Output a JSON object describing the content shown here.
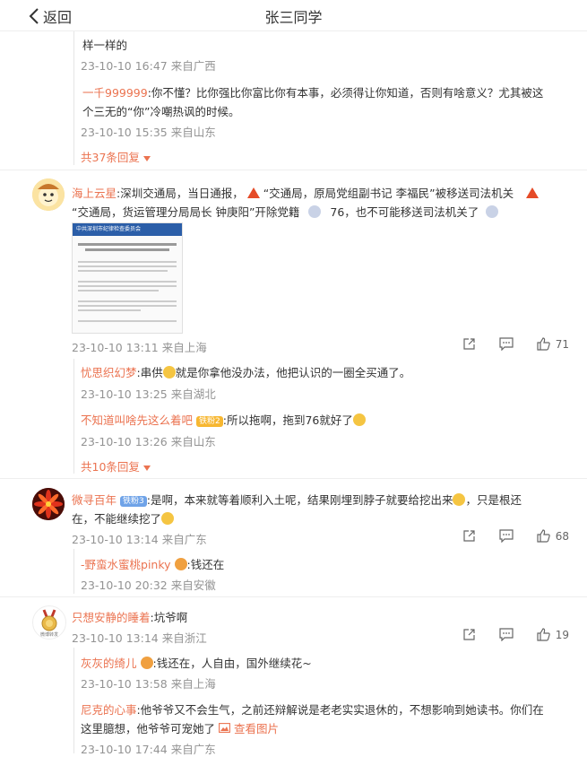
{
  "header": {
    "back_label": "返回",
    "title": "张三同学"
  },
  "r0": {
    "text_tail": "样一样的",
    "meta": "23-10-10 16:47 来自广西"
  },
  "r1": {
    "user": "一千999999",
    "text1": ":你不懂？比你强比你富比你有本事，必须得让你知道，否则有啥意义？尤其被这",
    "text2": "个三无的“你”冷嘲热讽的时候。",
    "meta": "23-10-10 15:35 来自山东"
  },
  "more1": "共37条回复",
  "c1": {
    "user": "海上云星",
    "line1_a": ":深圳交通局，当日通报，",
    "line1_b": "“交通局，原局党组副书记  李福民”被移送司法机关",
    "line2_a": "“交通局，货运管理分局局长 钟庚阳”开除党籍",
    "line2_b": "76，也不可能移送司法机关了",
    "meta": "23-10-10 13:11 来自上海",
    "likes": "71",
    "image_header": "中共深圳市纪律检查委员会"
  },
  "c1r1": {
    "user": "忧思织幻梦",
    "text_a": ":串供",
    "text_b": "就是你拿他没办法，他把认识的一圈全买通了。",
    "meta": "23-10-10 13:25 来自湖北"
  },
  "c1r2": {
    "user": "不知道叫啥先这么着吧",
    "badge": "铁粉2",
    "text": ":所以拖啊，拖到76就好了",
    "meta": "23-10-10 13:26 来自山东"
  },
  "more2": "共10条回复",
  "c2": {
    "user": "微寻百年",
    "badge": "铁粉3",
    "text1": ":是啊，本来就等着顺利入土呢，结果刚埋到脖子就要给挖出来",
    "text1b": "，只是根还",
    "text2": "在，不能继续挖了",
    "meta": "23-10-10 13:14 来自广东",
    "likes": "68"
  },
  "c2r1": {
    "user": "-野蛮水蜜桃pinky",
    "text": ":钱还在",
    "meta": "23-10-10 20:32 来自安徽"
  },
  "c3": {
    "user": "只想安静的睡着",
    "text": ":坑爷啊",
    "meta": "23-10-10 13:14 来自浙江",
    "likes": "19",
    "avatar_text": "微博转发"
  },
  "c3r1": {
    "user": "灰灰的绮儿",
    "text": ":钱还在，人自由，国外继续花~",
    "meta": "23-10-10 13:58 来自上海"
  },
  "c3r2": {
    "user": "尼克的心事",
    "text1": ":他爷爷又不会生气，之前还辩解说是老老实实退休的，不想影响到她读书。你们在",
    "text2": "这里臆想，他爷爷可宠她了",
    "view_pic": "查看图片",
    "meta": "23-10-10 17:44 来自广东"
  },
  "colors": {
    "accent": "#eb7350",
    "meta": "#939393"
  },
  "icons": [
    "chevron-left-icon",
    "share-icon",
    "comment-icon",
    "like-icon",
    "caret-down-icon",
    "picture-icon",
    "warning-icon",
    "emoji-icon"
  ]
}
